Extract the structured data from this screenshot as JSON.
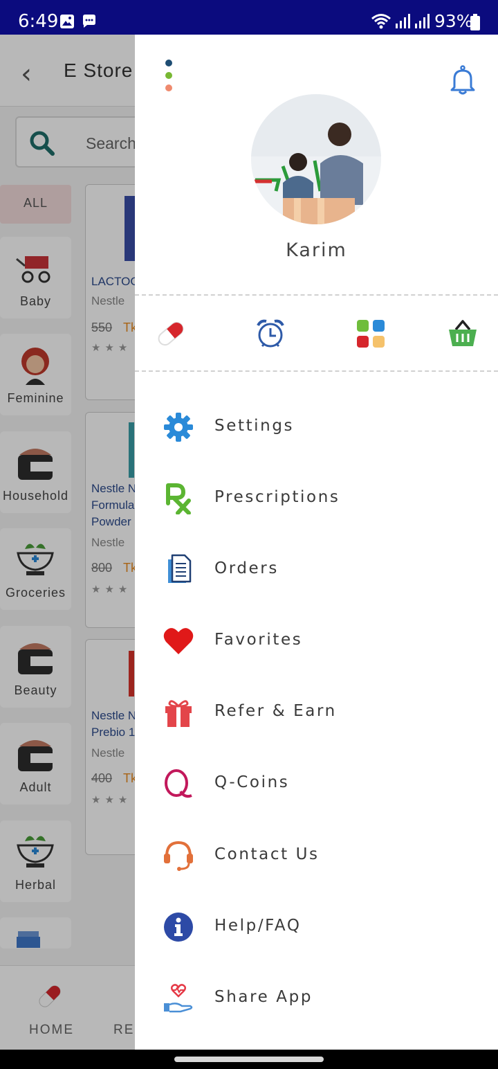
{
  "status_bar": {
    "time": "6:49",
    "battery": "93%"
  },
  "background": {
    "title": "E Store",
    "search_placeholder": "Search",
    "all_label": "ALL",
    "categories": [
      "Baby",
      "Feminine",
      "Household",
      "Groceries",
      "Beauty",
      "Adult",
      "Herbal"
    ],
    "products": [
      {
        "name": "LACTOG",
        "brand": "Nestle",
        "price": "550",
        "currency": "Tk"
      },
      {
        "name": "Nestle N\nFormula\nPowder",
        "brand": "Nestle",
        "price": "800",
        "currency": "Tk"
      },
      {
        "name": "Nestle N\nPrebio 1",
        "brand": "Nestle",
        "price": "400",
        "currency": "Tk"
      }
    ],
    "nav": {
      "home": "HOME",
      "reminder": "REM"
    }
  },
  "drawer": {
    "username": "Karim",
    "quick_actions": [
      "pill-icon",
      "alarm-clock-icon",
      "apps-grid-icon",
      "basket-icon"
    ],
    "menu": [
      {
        "label": "Settings",
        "icon": "gear-icon",
        "color": "#2a8ad8"
      },
      {
        "label": "Prescriptions",
        "icon": "rx-icon",
        "color": "#5bb532"
      },
      {
        "label": "Orders",
        "icon": "document-icon",
        "color": "#1f4fa0"
      },
      {
        "label": "Favorites",
        "icon": "heart-icon",
        "color": "#e01919"
      },
      {
        "label": "Refer & Earn",
        "icon": "gift-icon",
        "color": "#e3454a"
      },
      {
        "label": "Q-Coins",
        "icon": "q-coin-icon",
        "color": "#c2185b"
      },
      {
        "label": "Contact Us",
        "icon": "headset-icon",
        "color": "#e2703a"
      },
      {
        "label": "Help/FAQ",
        "icon": "info-icon",
        "color": "#2d4aa6"
      },
      {
        "label": "Share App",
        "icon": "share-hand-icon",
        "color": "#e53946"
      }
    ]
  }
}
